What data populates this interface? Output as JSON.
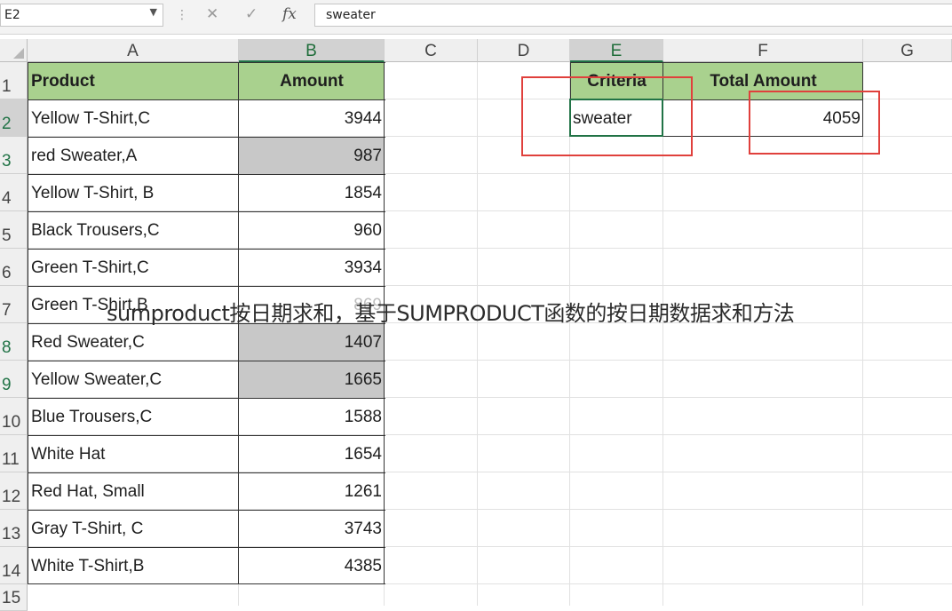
{
  "formula_bar": {
    "name_box": "E2",
    "cancel_icon": "✕",
    "enter_icon": "✓",
    "fx_label": "fx",
    "value": "sweater"
  },
  "columns": [
    "A",
    "B",
    "C",
    "D",
    "E",
    "F",
    "G"
  ],
  "rows": [
    "1",
    "2",
    "3",
    "4",
    "5",
    "6",
    "7",
    "8",
    "9",
    "10",
    "11",
    "12",
    "13",
    "14",
    "15"
  ],
  "table": {
    "headers": [
      "Product",
      "Amount"
    ],
    "rows": [
      {
        "product": "Yellow T-Shirt,C",
        "amount": "3944"
      },
      {
        "product": "red Sweater,A",
        "amount": "987"
      },
      {
        "product": "Yellow T-Shirt, B",
        "amount": "1854"
      },
      {
        "product": "Black Trousers,C",
        "amount": "960"
      },
      {
        "product": "Green T-Shirt,C",
        "amount": "3934"
      },
      {
        "product": "Green T-Shirt,B",
        "amount": "869"
      },
      {
        "product": "Red Sweater,C",
        "amount": "1407"
      },
      {
        "product": "Yellow Sweater,C",
        "amount": "1665"
      },
      {
        "product": "Blue Trousers,C",
        "amount": "1588"
      },
      {
        "product": "White Hat",
        "amount": "1654"
      },
      {
        "product": "Red Hat, Small",
        "amount": "1261"
      },
      {
        "product": "Gray T-Shirt, C",
        "amount": "3743"
      },
      {
        "product": "White T-Shirt,B",
        "amount": "4385"
      }
    ]
  },
  "criteria": {
    "header": "Criteria",
    "value": "sweater"
  },
  "total": {
    "header": "Total Amount",
    "value": "4059"
  },
  "overlay_title": "sumproduct按日期求和，基于SUMPRODUCT函数的按日期数据求和方法",
  "colors": {
    "header_fill": "#a9d18e",
    "highlight_fill": "#c8c8c8",
    "annotation_red": "#e0403c",
    "excel_green": "#217346"
  }
}
